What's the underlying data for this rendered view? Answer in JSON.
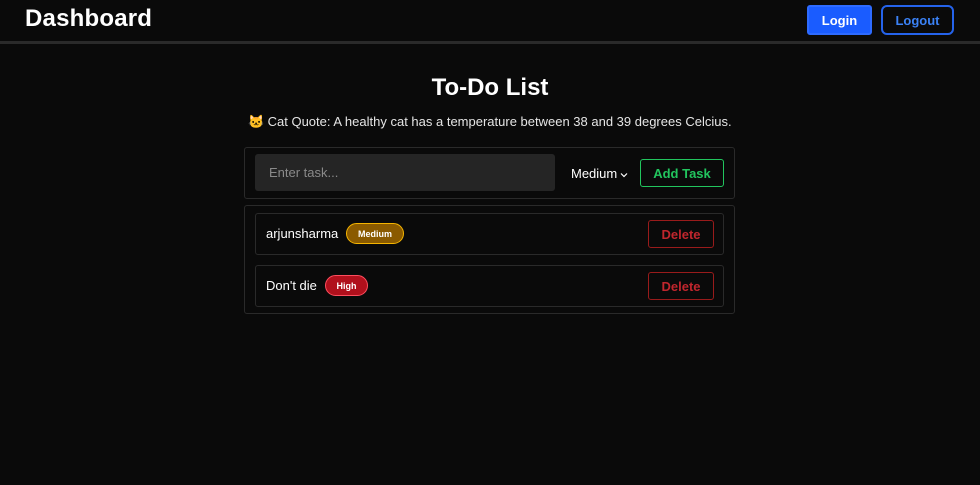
{
  "header": {
    "brand": "Dashboard",
    "login_label": "Login",
    "logout_label": "Logout"
  },
  "main": {
    "title": "To-Do List",
    "quote_emoji": "🐱",
    "quote_text": "Cat Quote: A healthy cat has a temperature between 38 and 39 degrees Celcius."
  },
  "form": {
    "task_placeholder": "Enter task...",
    "task_value": "",
    "priority_value": "Medium",
    "add_label": "Add Task"
  },
  "tasks": [
    {
      "name": "arjunsharma",
      "priority": "Medium",
      "delete_label": "Delete"
    },
    {
      "name": "Don't die",
      "priority": "High",
      "delete_label": "Delete"
    }
  ],
  "colors": {
    "background": "#0a0a0a",
    "login_bg": "#1a5cff",
    "logout_border": "#2563eb",
    "add_green": "#22c55e",
    "delete_red": "#991b1b",
    "medium_badge": "#8a5a00",
    "high_badge": "#b0101c"
  }
}
